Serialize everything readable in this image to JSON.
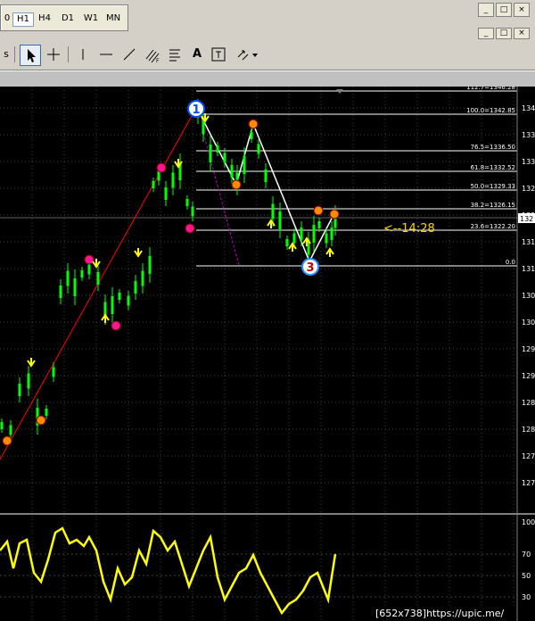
{
  "timeframes": [
    "0",
    "H1",
    "H4",
    "D1",
    "W1",
    "MN"
  ],
  "active_timeframe": "H1",
  "window_buttons": [
    "_",
    "□",
    "×"
  ],
  "toolbar": {
    "left_edge_label": "s",
    "tools": [
      "cursor",
      "crosshair",
      "vertical-line",
      "horizontal-line",
      "trend-line",
      "fibonacci-channel",
      "text",
      "text-label",
      "arrows"
    ],
    "text_tool_glyph": "A",
    "fib_glyph": "F"
  },
  "fib_levels": [
    {
      "label": "112.7=1346.28"
    },
    {
      "label": "100.0=1342.85"
    },
    {
      "label": "76.5=1336.50"
    },
    {
      "label": "61.8=1332.52"
    },
    {
      "label": "50.0=1329.33"
    },
    {
      "label": "38.2=1326.15"
    },
    {
      "label": "23.6=1322.20"
    },
    {
      "label": "0.0"
    }
  ],
  "price_ticks": [
    "134",
    "133",
    "133",
    "132",
    "132",
    "131",
    "131",
    "130",
    "130",
    "129",
    "129",
    "128",
    "128",
    "127",
    "127"
  ],
  "current_price_tag": "132",
  "time_annotation": "<--14:28",
  "wave_labels": [
    "1",
    "3"
  ],
  "oscillator_ticks": [
    "100",
    "70",
    "50",
    "30"
  ],
  "watermark": "[652x738]https://upic.me/",
  "colors": {
    "candle": "#00ff00",
    "oscillator": "#ffff00",
    "grid": "#404040",
    "fib_line": "#ffffff",
    "annotation": "#ffd700",
    "trend_line": "#ff0000",
    "fractal_marker": "#ff1493",
    "arrow_marker": "#ffff00"
  }
}
